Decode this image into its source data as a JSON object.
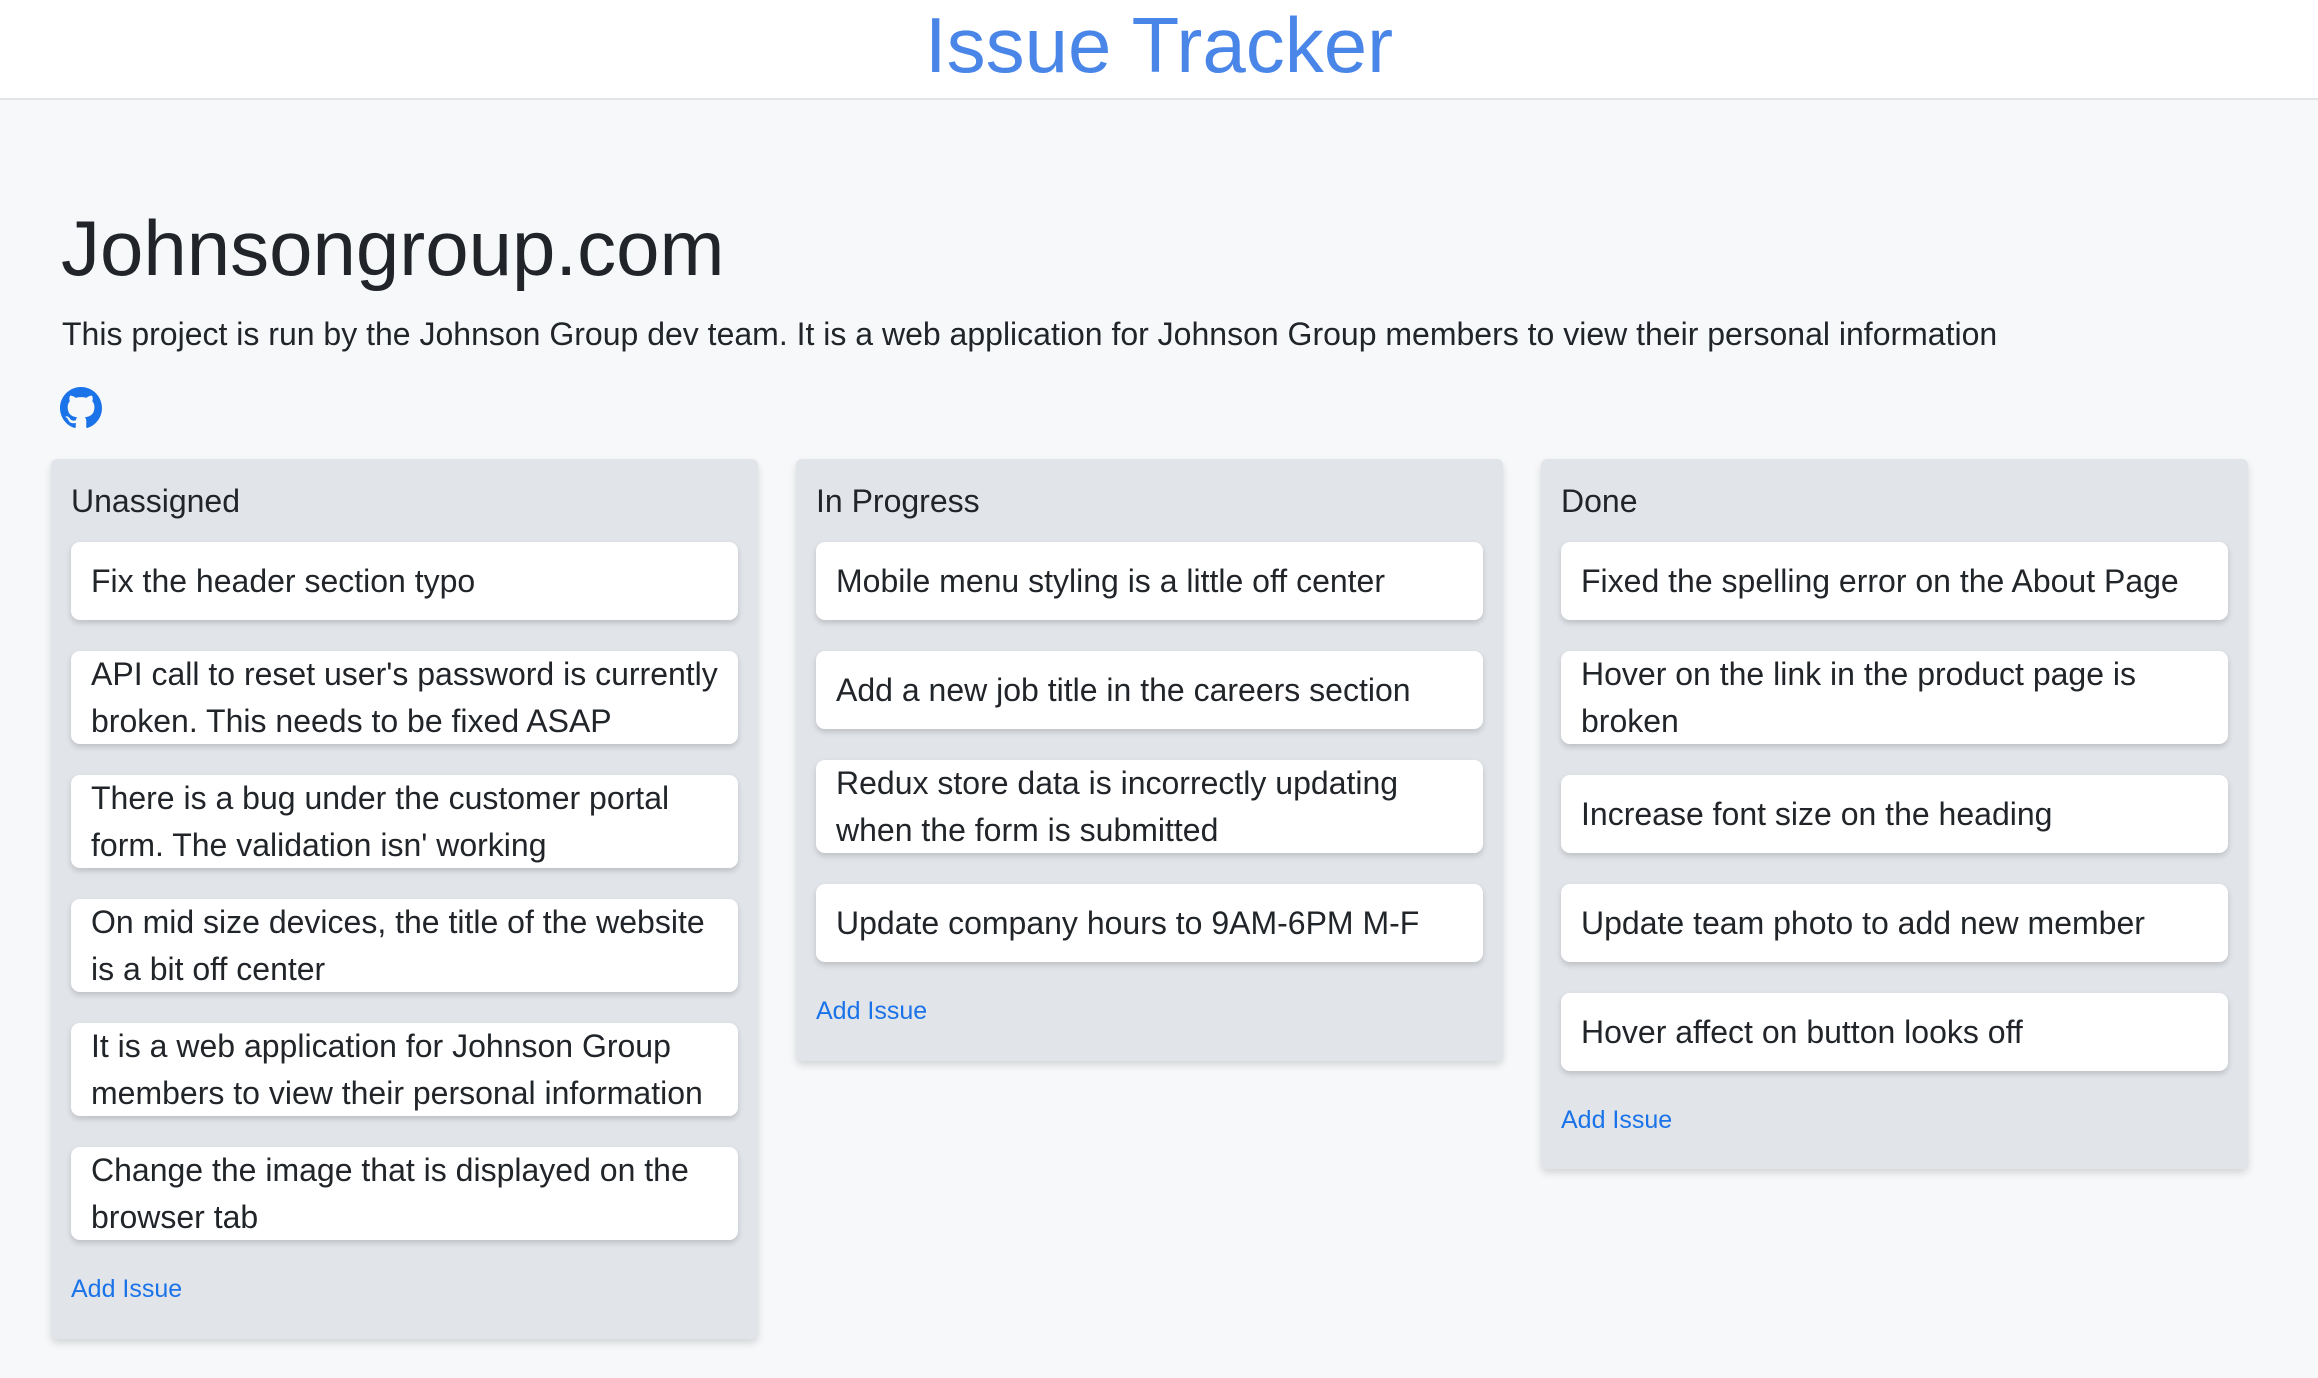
{
  "header": {
    "app_title": "Issue Tracker"
  },
  "project": {
    "title": "Johnsongroup.com",
    "description": "This project is run by the Johnson Group dev team. It is a web application for Johnson Group members to view their personal information",
    "repo_icon": "github-icon"
  },
  "columns": [
    {
      "title": "Unassigned",
      "add_label": "Add Issue",
      "cards": [
        "Fix the header section typo",
        "API call to reset user's password is currently broken. This needs to be fixed ASAP",
        "There is a bug under the customer portal form. The validation isn' working",
        "On mid size devices, the title of the website is a bit off center",
        "It is a web application for Johnson Group members to view their personal information",
        "Change the image that is displayed on the browser tab"
      ]
    },
    {
      "title": "In Progress",
      "add_label": "Add Issue",
      "cards": [
        "Mobile menu styling is a little off center",
        "Add a new job title in the careers section",
        "Redux store data is incorrectly updating when the form is submitted",
        "Update company hours to 9AM-6PM M-F"
      ]
    },
    {
      "title": "Done",
      "add_label": "Add Issue",
      "cards": [
        "Fixed the spelling error on the About Page",
        "Hover on the link in the product page is broken",
        "Increase font size on the heading",
        "Update team photo to add new member",
        "Hover affect on button looks off"
      ]
    }
  ],
  "colors": {
    "accent": "#4a86e8",
    "link": "#1a73e8",
    "column_bg": "#e1e4e9",
    "page_bg": "#f7f8fa"
  }
}
